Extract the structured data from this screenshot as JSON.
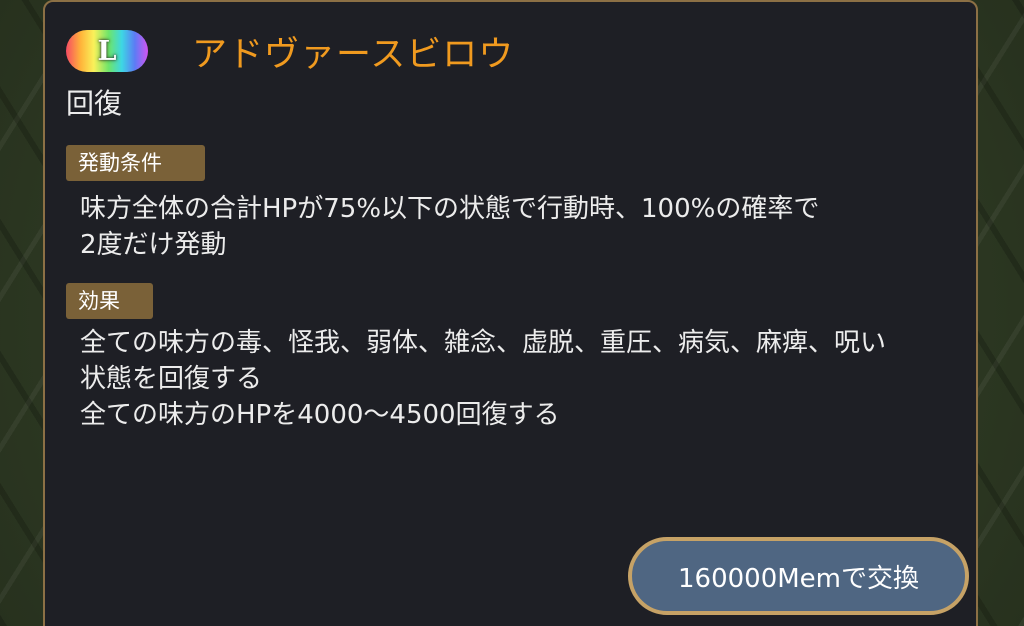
{
  "skill": {
    "rarity": "L",
    "name": "アドヴァースビロウ",
    "type": "回復"
  },
  "condition": {
    "label": "発動条件",
    "lines": [
      "味方全体の合計HPが75%以下の状態で行動時、100%の確率で",
      "2度だけ発動"
    ]
  },
  "effect": {
    "label": "効果",
    "lines": [
      "全ての味方の毒、怪我、弱体、雑念、虚脱、重圧、病気、麻痺、呪い",
      "状態を回復する",
      "全ての味方のHPを4000〜4500回復する"
    ]
  },
  "exchange_button": {
    "label": "160000Memで交換"
  },
  "colors": {
    "skill_name": "#f09a1f",
    "panel_bg": "#1e1f25",
    "panel_border": "#8c7045",
    "tag_bg": "#7a6138",
    "button_bg": "#4f6682",
    "button_border": "#c6a266"
  }
}
